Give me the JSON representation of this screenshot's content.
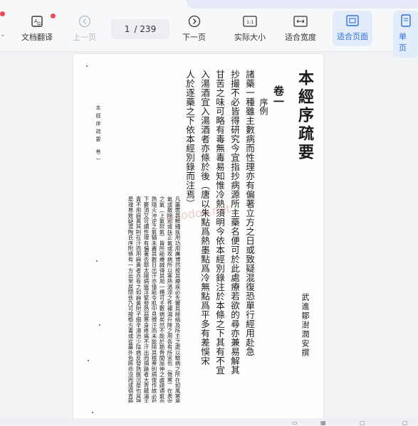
{
  "toolbar": {
    "doc_translate": "文档翻译",
    "prev_page": "上一页",
    "next_page": "下一页",
    "actual_size": "实际大小",
    "fit_width": "适合宽度",
    "fit_page": "适合页面",
    "single_page": "单页",
    "actual_size_glyph": "1:1",
    "page_current": "1",
    "page_total": "/ 239"
  },
  "document": {
    "title": "本經序疏要",
    "juan": "卷一",
    "preface": "序例",
    "author": "武進鄒澍潤安撰",
    "margin_label": "本經序疏要  卷一",
    "watermark": "Haodoo.net",
    "main_text": [
      "諸藥一種雖主數病而性理亦有偏著立方之日或致疑混復恐單行經用赴急",
      "抄撮不必皆得研究今宜指抄病源所主藥名便可於此處療若欲的尋亦兼易解其",
      "甘苦之味可略有毒無毒易知惟冷熱須明今依本經別錄注於本條之下其有不宜",
      "入湯酒宜入湯酒者亦條於後（唐以朱點爲熱墨點爲冷無點爲平多有差悞宋",
      "人於逐藥之下依本經別錄而注焉）"
    ],
    "commentary": [
      "凡藥篋甚鮮繩疾用功用廣博然按其療疾必先審其經絡及所主之處以驗病之所在如風寒暑濕之邪各有所入如某經",
      "氣或散除邪或扶正氣或攻病所以寒熱溫涼之性補瀉升降之用各有所宜也（傷寒）在表宜發汗在裏宜攻下（溫疫）",
      "之氣（上氣欬氣）皆所能療誠得其用一種可主數病矣然不能於筋骨間屈伸之處疏通氣血使之條達則病不能去也",
      "熱隨火沖逆之氣猶未盡其數日出汗亦僅能令肌中見微汗而未能除其根蒂則病復作故必於橫中尋其邪之所著而攻",
      "下鬱須又可謂性理有偏著否耶太陽病脈浮緊發熱惡寒身疼痛不汗出而煩躁者大青龍湯主之是其例也凡方必有主藥",
      "責不用麻黃其則在汗而用麻黃者亦有之如麻黃附子細辛湯治少陰病反發熱脈沉是也其理在於此而不在於彼也",
      "是理易致疑混陶氏序附條有一方云常居閒佚乃可按檢方書或從藥外色將命沒而或宿直檢閱急奔醫絕"
    ]
  }
}
